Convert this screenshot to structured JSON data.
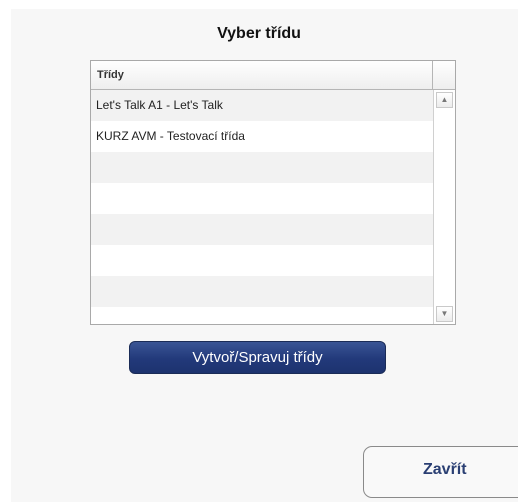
{
  "dialog": {
    "title": "Vyber třídu",
    "list": {
      "header": "Třídy",
      "items": [
        "Let's Talk A1 - Let's Talk",
        "KURZ AVM - Testovací třída",
        "",
        "",
        "",
        "",
        "",
        ""
      ]
    },
    "manage_button": "Vytvoř/Spravuj třídy",
    "close_button": "Zavřít"
  },
  "colors": {
    "manage_button": "#22397a",
    "close_text": "#2a3f73"
  },
  "icons": {
    "scroll_up": "triangle-up",
    "scroll_down": "triangle-down"
  }
}
